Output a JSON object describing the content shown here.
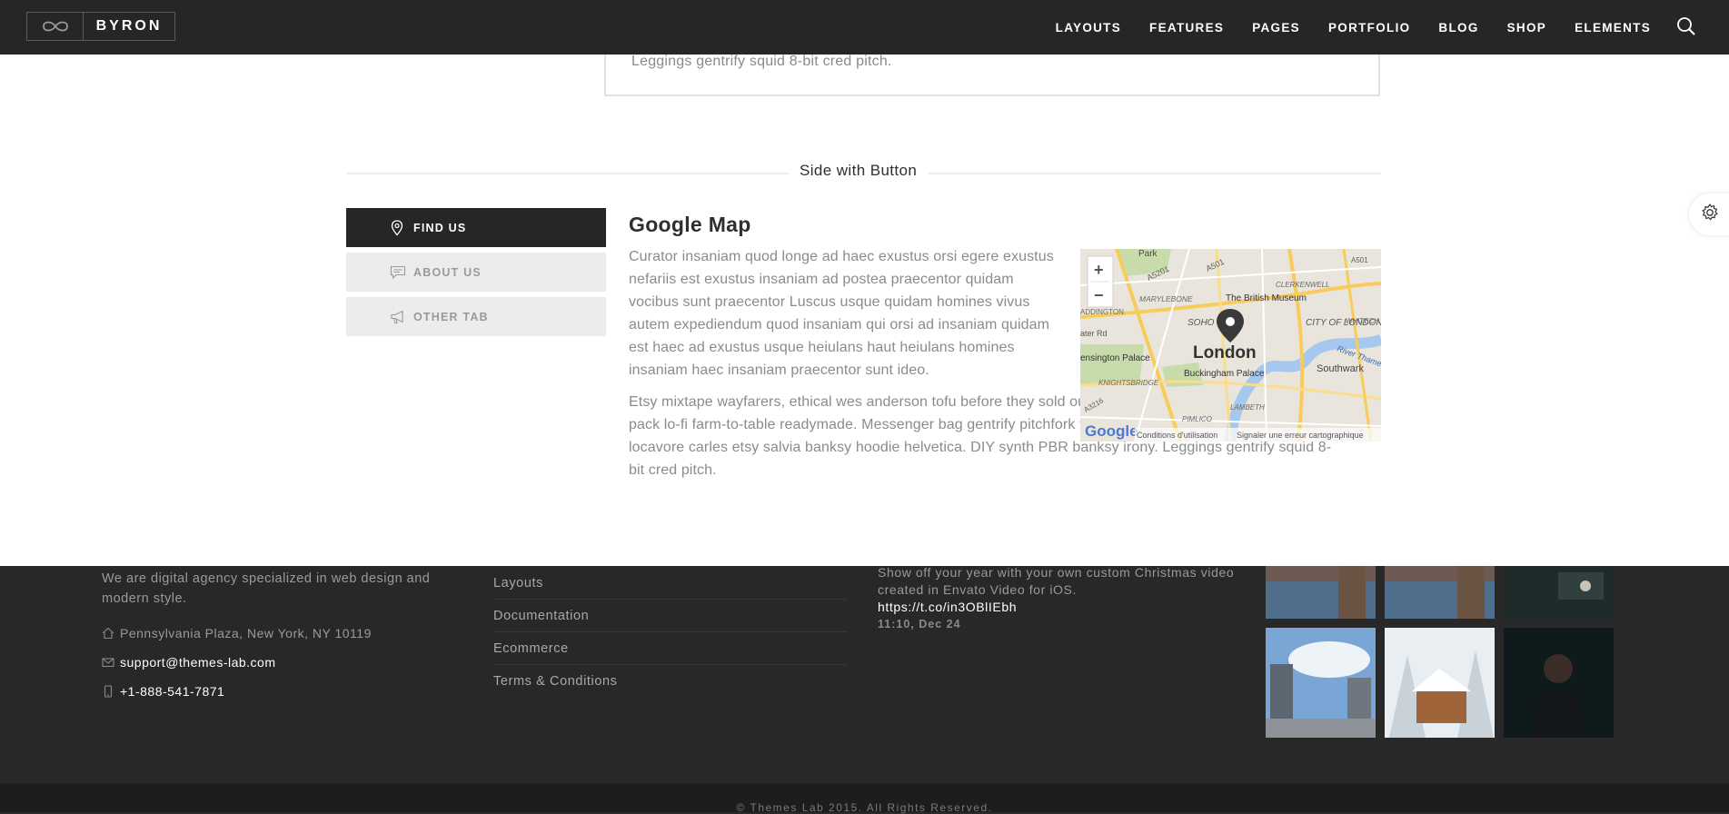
{
  "header": {
    "logo_text": "BYRON",
    "nav": [
      "LAYOUTS",
      "FEATURES",
      "PAGES",
      "PORTFOLIO",
      "BLOG",
      "SHOP",
      "ELEMENTS"
    ],
    "search_icon": "search-icon"
  },
  "card": {
    "text": "Leggings gentrify squid 8-bit cred pitch."
  },
  "section": {
    "title": "Side with Button"
  },
  "tabs": [
    {
      "label": "FIND US",
      "icon": "map-pin-icon",
      "active": true
    },
    {
      "label": "ABOUT US",
      "icon": "chat-icon",
      "active": false
    },
    {
      "label": "OTHER TAB",
      "icon": "megaphone-icon",
      "active": false
    }
  ],
  "content": {
    "heading": "Google Map",
    "p1": "Curator insaniam quod longe ad haec exustus orsi egere exustus nefariis est exustus insaniam ad postea praecentor quidam vocibus sunt praecentor Luscus usque quidam homines vivus autem expediendum quod insaniam qui orsi ad insaniam quidam est haec ad exustus usque heiulans haut heiulans homines insaniam haec insaniam praecentor sunt ideo.",
    "p2": "Etsy mixtape wayfarers, ethical wes anderson tofu before they sold out mcsweeney's organic lomo retro fanny pack lo-fi farm-to-table readymade. Messenger bag gentrify pitchfork tattooed craft beer, iphone skateboard locavore carles etsy salvia banksy hoodie helvetica. DIY synth PBR banksy irony. Leggings gentrify squid 8-bit cred pitch."
  },
  "map": {
    "zoom_in": "+",
    "zoom_out": "−",
    "city": "London",
    "labels": {
      "park": "Park",
      "a501": "A501",
      "a5201": "A5201",
      "marylebone": "MARYLEBONE",
      "clerkenwell": "CLERKENWELL",
      "british_museum": "The British Museum",
      "addington": "ADDINGTON",
      "soho": "SOHO",
      "city_of_london": "CITY OF LONDON",
      "whitechapel": "WHITECH",
      "water_rd": "ater Rd",
      "kensington_palace": "ensington Palace",
      "river_thames": "River Thame",
      "buckingham_palace": "Buckingham Palace",
      "southwark": "Southwark",
      "knightsbridge": "KNIGHTSBRIDGE",
      "lambeth": "LAMBETH",
      "pimlico": "PIMLICO",
      "a3216": "A3216"
    },
    "google": "Google",
    "terms": "Conditions d'utilisation",
    "report": "Signaler une erreur cartographique"
  },
  "footer": {
    "about": "We are digital agency specialized in web design and modern style.",
    "address": "Pennsylvania Plaza, New York, NY 10119",
    "email": "support@themes-lab.com",
    "phone": "+1-888-541-7871",
    "links": [
      "Layouts",
      "Documentation",
      "Ecommerce",
      "Terms & Conditions"
    ],
    "tweet": {
      "text": "Show off your year with your own custom Christmas video created in Envato Video for iOS.",
      "link": "https://t.co/in3OBlIEbh",
      "time": "11:10, Dec 24"
    },
    "copyright": "© Themes Lab 2015. All Rights Reserved."
  },
  "colors": {
    "header_bg": "#262626",
    "footer_bg": "#282828",
    "active_tab": "#262626",
    "inactive_tab": "#ececec"
  }
}
